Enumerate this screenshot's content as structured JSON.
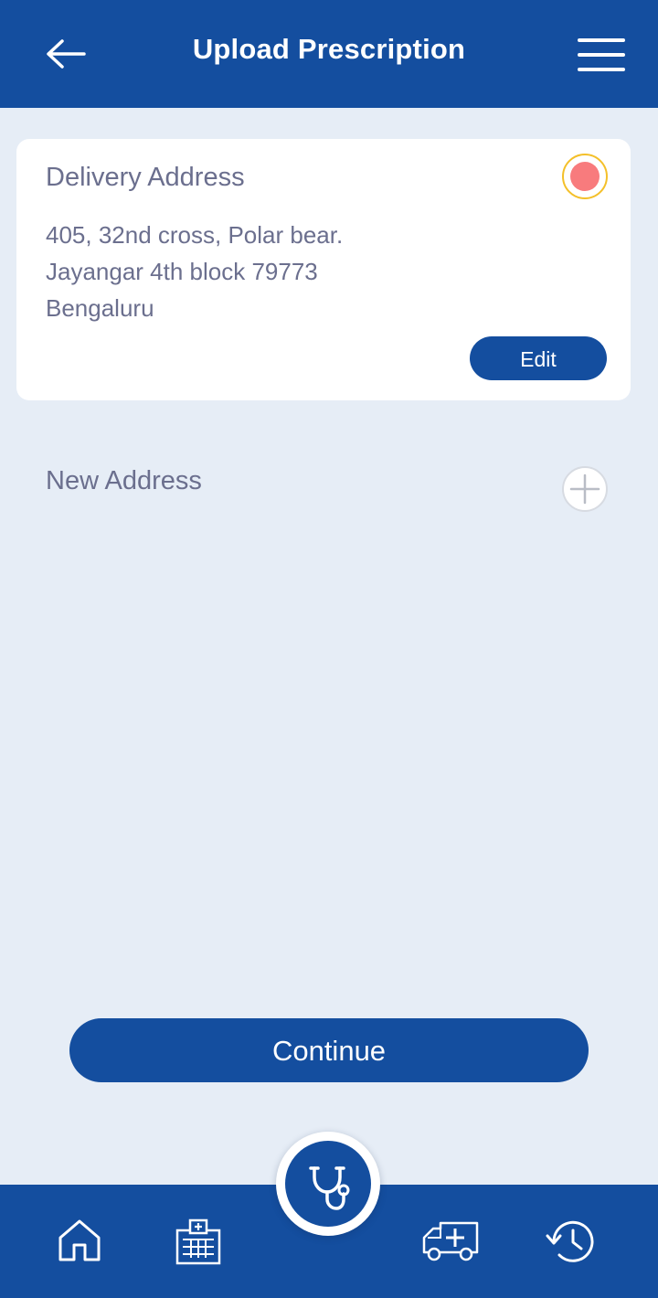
{
  "header": {
    "title": "Upload Prescription",
    "back_icon": "arrow-left-icon",
    "menu_icon": "hamburger-menu-icon"
  },
  "delivery_address": {
    "title": "Delivery Address",
    "lines": [
      "405, 32nd cross, Polar bear.",
      "Jayangar 4th block 79773",
      "Bengaluru"
    ],
    "selected": true,
    "edit_label": "Edit"
  },
  "new_address": {
    "label": "New Address",
    "add_icon": "plus-icon"
  },
  "continue_label": "Continue",
  "bottom_nav": {
    "items": [
      "home-icon",
      "hospital-icon",
      "stethoscope-icon",
      "ambulance-icon",
      "history-icon"
    ]
  },
  "colors": {
    "primary": "#144e9f",
    "background": "#e6edf6",
    "text_muted": "#6b6f8e",
    "radio_ring": "#f4c02a",
    "radio_dot": "#f87b7d"
  }
}
